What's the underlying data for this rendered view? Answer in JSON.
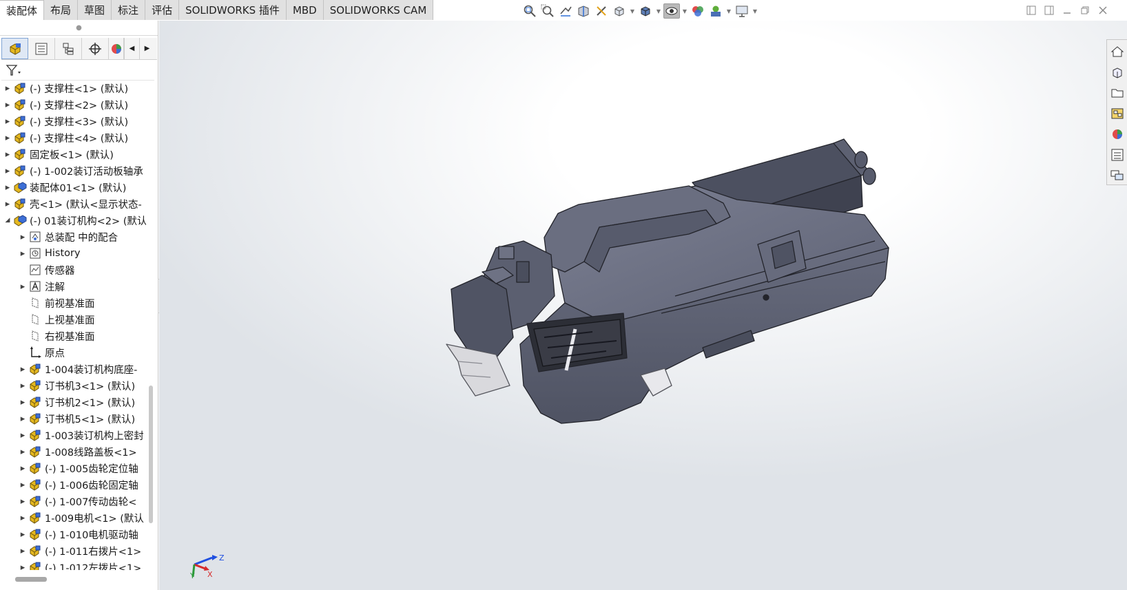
{
  "command_tabs": [
    "装配体",
    "布局",
    "草图",
    "标注",
    "评估",
    "SOLIDWORKS 插件",
    "MBD",
    "SOLIDWORKS CAM"
  ],
  "active_tab": "装配体",
  "hud_icons": [
    "zoom-to-fit-icon",
    "zoom-to-area-icon",
    "previous-view-icon",
    "section-view-icon",
    "dynamic-annotation-icon",
    "view-orientation-icon",
    "display-style-icon",
    "hide-show-items-icon",
    "edit-appearance-icon",
    "apply-scene-icon",
    "view-settings-icon"
  ],
  "panel_tabs": [
    "featuremanager-tab",
    "propertymanager-tab",
    "configurationmanager-tab",
    "dimxpert-tab",
    "display-manager-tab"
  ],
  "tree": [
    {
      "label": "(-) 支撑柱<1> (默认)",
      "level": 0,
      "expander": "collapsed",
      "icon": "part"
    },
    {
      "label": "(-) 支撑柱<2> (默认)",
      "level": 0,
      "expander": "collapsed",
      "icon": "part"
    },
    {
      "label": "(-) 支撑柱<3> (默认)",
      "level": 0,
      "expander": "collapsed",
      "icon": "part"
    },
    {
      "label": "(-) 支撑柱<4> (默认)",
      "level": 0,
      "expander": "collapsed",
      "icon": "part"
    },
    {
      "label": "固定板<1> (默认)",
      "level": 0,
      "expander": "collapsed",
      "icon": "part"
    },
    {
      "label": "(-) 1-002装订活动板轴承",
      "level": 0,
      "expander": "collapsed",
      "icon": "part"
    },
    {
      "label": "装配体01<1> (默认)",
      "level": 0,
      "expander": "collapsed",
      "icon": "assembly"
    },
    {
      "label": "壳<1> (默认<显示状态-",
      "level": 0,
      "expander": "collapsed",
      "icon": "part"
    },
    {
      "label": "(-) 01装订机构<2> (默认",
      "level": 0,
      "expander": "expanded",
      "icon": "assembly"
    },
    {
      "label": "总装配 中的配合",
      "level": 1,
      "expander": "collapsed",
      "icon": "mates"
    },
    {
      "label": "History",
      "level": 1,
      "expander": "collapsed",
      "icon": "history"
    },
    {
      "label": "传感器",
      "level": 1,
      "expander": "none",
      "icon": "sensor"
    },
    {
      "label": "注解",
      "level": 1,
      "expander": "collapsed",
      "icon": "annotation"
    },
    {
      "label": "前视基准面",
      "level": 1,
      "expander": "none",
      "icon": "plane"
    },
    {
      "label": "上视基准面",
      "level": 1,
      "expander": "none",
      "icon": "plane"
    },
    {
      "label": "右视基准面",
      "level": 1,
      "expander": "none",
      "icon": "plane"
    },
    {
      "label": "原点",
      "level": 1,
      "expander": "none",
      "icon": "origin"
    },
    {
      "label": "1-004装订机构底座-",
      "level": 1,
      "expander": "collapsed",
      "icon": "part"
    },
    {
      "label": "订书机3<1> (默认)",
      "level": 1,
      "expander": "collapsed",
      "icon": "part"
    },
    {
      "label": "订书机2<1> (默认)",
      "level": 1,
      "expander": "collapsed",
      "icon": "part"
    },
    {
      "label": "订书机5<1> (默认)",
      "level": 1,
      "expander": "collapsed",
      "icon": "part"
    },
    {
      "label": "1-003装订机构上密封",
      "level": 1,
      "expander": "collapsed",
      "icon": "part"
    },
    {
      "label": "1-008线路盖板<1>",
      "level": 1,
      "expander": "collapsed",
      "icon": "part"
    },
    {
      "label": "(-) 1-005齿轮定位轴",
      "level": 1,
      "expander": "collapsed",
      "icon": "part"
    },
    {
      "label": "(-) 1-006齿轮固定轴",
      "level": 1,
      "expander": "collapsed",
      "icon": "part"
    },
    {
      "label": "(-) 1-007传动齿轮<",
      "level": 1,
      "expander": "collapsed",
      "icon": "part"
    },
    {
      "label": "1-009电机<1> (默认",
      "level": 1,
      "expander": "collapsed",
      "icon": "part"
    },
    {
      "label": "(-) 1-010电机驱动轴",
      "level": 1,
      "expander": "collapsed",
      "icon": "part"
    },
    {
      "label": "(-) 1-011右拨片<1>",
      "level": 1,
      "expander": "collapsed",
      "icon": "part"
    },
    {
      "label": "(-) 1-012左拨片<1>",
      "level": 1,
      "expander": "collapsed",
      "icon": "part"
    }
  ],
  "task_pane": [
    "solidworks-resources-icon",
    "design-library-icon",
    "file-explorer-icon",
    "view-palette-icon",
    "appearances-icon",
    "custom-properties-icon",
    "forum-icon"
  ],
  "triad": {
    "x": "X",
    "y": "Y",
    "z": "Z"
  },
  "colors": {
    "model": "#5b5f70",
    "model_dark": "#3f4250",
    "model_light": "#7b7f90",
    "part_icon": "#e5b81f",
    "accent": "#2e6fd6"
  }
}
